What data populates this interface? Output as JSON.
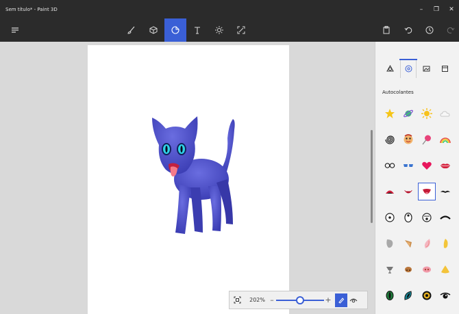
{
  "window": {
    "title": "Sem título* - Paint 3D",
    "controls": [
      "minimize",
      "restore",
      "close"
    ]
  },
  "toolbar": {
    "menu_icon": "hamburger-icon",
    "tools": [
      {
        "name": "brushes",
        "icon": "brush-icon",
        "active": false
      },
      {
        "name": "3d-shapes",
        "icon": "cube-icon",
        "active": false
      },
      {
        "name": "stickers",
        "icon": "sticker-icon",
        "active": true
      },
      {
        "name": "text",
        "icon": "text-icon",
        "active": false
      },
      {
        "name": "effects",
        "icon": "sun-icon",
        "active": false
      },
      {
        "name": "canvas",
        "icon": "canvas-icon",
        "active": false
      }
    ],
    "right_actions": [
      "paste-icon",
      "undo-icon",
      "history-icon",
      "redo-icon"
    ]
  },
  "panel": {
    "tabs": [
      {
        "icon": "shapes-tab-icon",
        "active": false
      },
      {
        "icon": "stickers-tab-icon",
        "active": true
      },
      {
        "icon": "textures-tab-icon",
        "active": false
      },
      {
        "icon": "custom-sticker-tab-icon",
        "active": false
      }
    ],
    "section_label": "Autocolantes",
    "stickers": [
      "star",
      "planet",
      "sun",
      "cloud",
      "spiral",
      "face",
      "lollipop",
      "rainbow",
      "glasses",
      "sunglasses",
      "heart",
      "lips",
      "mouth-open",
      "mouth-smile",
      "tongue-mouth",
      "mustache",
      "eye-round",
      "eye-oval",
      "eye-small",
      "eyebrow",
      "ear-gray",
      "ear-brown",
      "ear-pink",
      "ear-yellow",
      "nose-gray",
      "nose-brown",
      "nose-pink",
      "nose-yellow",
      "eye-green",
      "eye-teal",
      "eye-gold",
      "eye-dark"
    ],
    "selected_index": 14
  },
  "zoom": {
    "value": "202%",
    "level": 0.5
  },
  "colors": {
    "accent": "#3a5fd6",
    "cat": "#4a4cc9"
  }
}
